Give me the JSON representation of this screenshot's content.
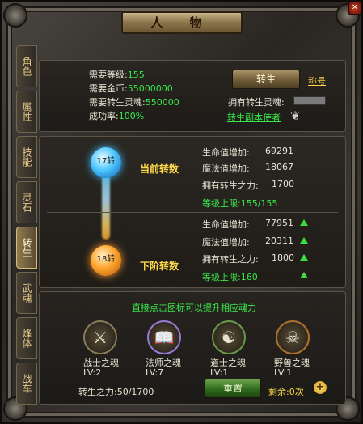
{
  "window": {
    "title": "人 物"
  },
  "tabs": [
    "角色",
    "属性",
    "技能",
    "灵石",
    "转生",
    "武魂",
    "烽体",
    "战车"
  ],
  "requirements": {
    "level_label": "需要等级:",
    "level_value": "155",
    "gold_label": "需要金币:",
    "gold_value": "55000000",
    "soul_label": "需要转生灵魂:",
    "soul_value": "550000",
    "rate_label": "成功率:",
    "rate_value": "100%"
  },
  "actions": {
    "rebirth_button": "转生",
    "title_link": "称号",
    "owned_soul_label": "拥有转生灵魂:",
    "dungeon_link": "转生副本使者"
  },
  "current": {
    "orb_label": "17转",
    "heading": "当前转数",
    "hp_label": "生命值增加:",
    "hp_value": "69291",
    "mp_label": "魔法值增加:",
    "mp_value": "18067",
    "power_label": "拥有转生之力:",
    "power_value": "1700",
    "cap": "等级上限:155/155"
  },
  "next": {
    "orb_label": "18转",
    "heading": "下阶转数",
    "hp_label": "生命值增加:",
    "hp_value": "77951",
    "mp_label": "魔法值增加:",
    "mp_value": "20311",
    "power_label": "拥有转生之力:",
    "power_value": "1800",
    "cap": "等级上限:160"
  },
  "souls": {
    "hint": "直接点击图标可以提升相应魂力",
    "items": [
      {
        "name": "战士之魂",
        "level": "LV:2"
      },
      {
        "name": "法师之魂",
        "level": "LV:7"
      },
      {
        "name": "道士之魂",
        "level": "LV:1"
      },
      {
        "name": "野兽之魂",
        "level": "LV:1"
      }
    ],
    "power_text": "转生之力:50/1700",
    "reset_button": "重置",
    "remaining_text": "剩余:0次"
  }
}
